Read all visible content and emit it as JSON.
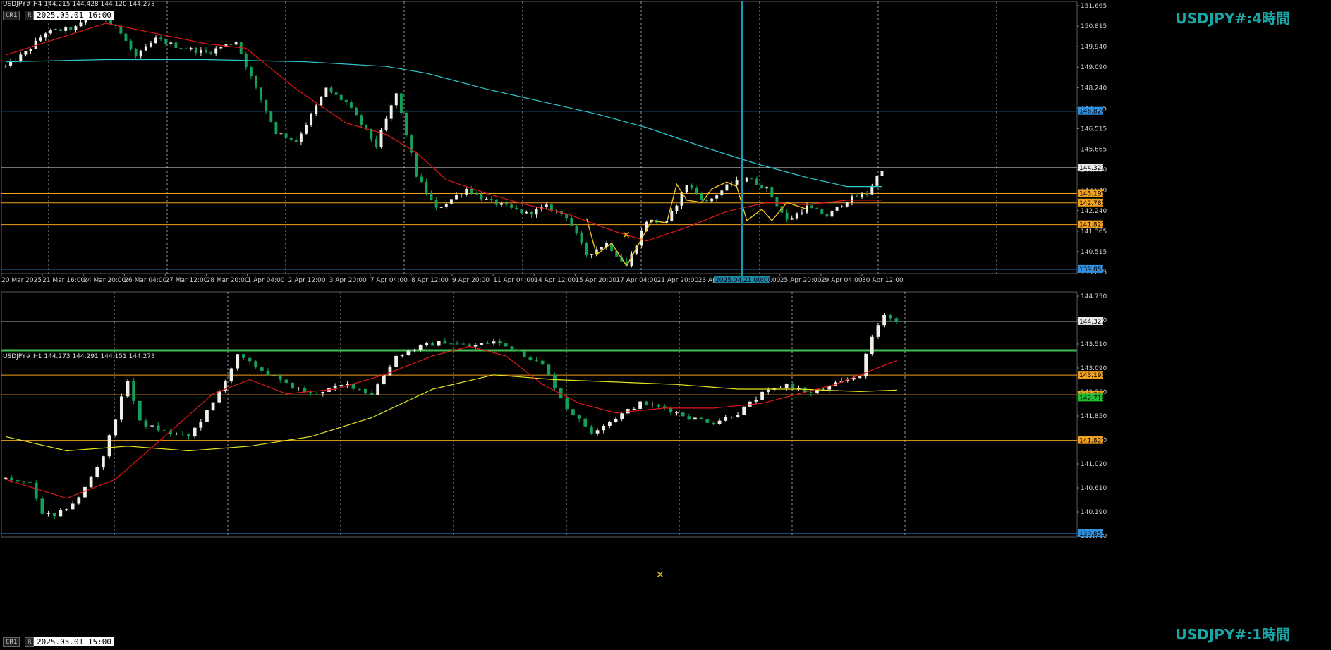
{
  "colors": {
    "bull": "#f0f0e8",
    "bear": "#14a058",
    "ma_red": "#e01818",
    "ma_cyan": "#2ec8d0",
    "ma_yellow": "#e6e61e",
    "zigzag": "#f0c020",
    "level_orange": "#f0a020",
    "level_white": "#e8e8e8",
    "level_blue": "#3090e0",
    "level_green": "#20c030",
    "grid": "#9a9a9a",
    "axis_text": "#d0d0d0",
    "title": "#19a6a6"
  },
  "window_buttons": {
    "cr": "CR1",
    "r": "R"
  },
  "top": {
    "header": "USDJPY#,H4  144.215 144.428 144.120 144.273",
    "time_stamp": "2025.05.01 16:00",
    "title": "USDJPY#:4時間",
    "cursor_time": "2025.04.21 00:00",
    "xticks": [
      "20 Mar 2025",
      "21 Mar 16:00",
      "24 Mar 20:00",
      "26 Mar 04:00",
      "27 Mar 12:00",
      "28 Mar 20:00",
      "1 Apr 04:00",
      "2 Apr 12:00",
      "3 Apr 20:00",
      "7 Apr 04:00",
      "8 Apr 12:00",
      "9 Apr 20:00",
      "11 Apr 04:00",
      "14 Apr 12:00",
      "15 Apr 20:00",
      "17 Apr 04:00",
      "21 Apr 20:00",
      "23 Apr 04:00",
      "24 Apr 12:00",
      "25 Apr 20:00",
      "29 Apr 04:00",
      "30 Apr 12:00"
    ],
    "yticks": [
      "151.665",
      "150.815",
      "149.940",
      "149.090",
      "148.240",
      "147.365",
      "146.515",
      "145.665",
      "144.790",
      "143.940",
      "142.240",
      "141.365",
      "140.515",
      "139.665"
    ]
  },
  "bottom": {
    "header": "USDJPY#,H1  144.273 144.291 144.151 144.273",
    "time_stamp": "2025.05.01 15:00",
    "title": "USDJPY#:1時間",
    "yticks": [
      "144.750",
      "143.920",
      "143.510",
      "143.090",
      "142.260",
      "141.850",
      "141.440",
      "141.020",
      "140.610",
      "140.190",
      "139.780"
    ]
  },
  "chart_data": [
    {
      "type": "candlestick",
      "symbol": "USDJPY#",
      "timeframe": "H4",
      "ylim": [
        139.665,
        151.665
      ],
      "price_labels": [
        {
          "value": "146.824",
          "color": "#3090e0",
          "price": 146.824
        },
        {
          "value": "144.327",
          "color": "#e8e8e8",
          "price": 144.327
        },
        {
          "value": "143.195",
          "color": "#f0a020",
          "price": 143.195
        },
        {
          "value": "142.780",
          "color": "#f0a020",
          "price": 142.78
        },
        {
          "value": "141.821",
          "color": "#f0a020",
          "price": 141.821
        },
        {
          "value": "139.855",
          "color": "#3090e0",
          "price": 139.855
        }
      ],
      "anchors": [
        [
          0,
          148.8
        ],
        [
          4,
          149.4
        ],
        [
          8,
          150.3
        ],
        [
          14,
          150.5
        ],
        [
          18,
          151.2
        ],
        [
          22,
          150.6
        ],
        [
          26,
          149.2
        ],
        [
          30,
          150.0
        ],
        [
          34,
          149.7
        ],
        [
          40,
          149.4
        ],
        [
          46,
          149.9
        ],
        [
          50,
          147.8
        ],
        [
          54,
          145.9
        ],
        [
          58,
          145.5
        ],
        [
          64,
          147.8
        ],
        [
          68,
          147.2
        ],
        [
          74,
          145.3
        ],
        [
          78,
          147.6
        ],
        [
          82,
          144.0
        ],
        [
          86,
          142.5
        ],
        [
          92,
          143.4
        ],
        [
          96,
          142.9
        ],
        [
          100,
          142.6
        ],
        [
          104,
          142.3
        ],
        [
          108,
          142.6
        ],
        [
          112,
          142.2
        ],
        [
          116,
          140.5
        ],
        [
          120,
          141.0
        ],
        [
          124,
          140.0
        ],
        [
          128,
          142.0
        ],
        [
          132,
          141.9
        ],
        [
          136,
          143.6
        ],
        [
          140,
          142.8
        ],
        [
          144,
          143.5
        ],
        [
          148,
          143.9
        ],
        [
          152,
          143.4
        ],
        [
          156,
          142.0
        ],
        [
          160,
          142.6
        ],
        [
          164,
          142.2
        ],
        [
          168,
          142.9
        ],
        [
          172,
          143.2
        ],
        [
          175,
          144.3
        ]
      ],
      "ma_red": [
        [
          0,
          149.3
        ],
        [
          20,
          150.7
        ],
        [
          40,
          149.8
        ],
        [
          48,
          149.6
        ],
        [
          58,
          147.8
        ],
        [
          68,
          146.3
        ],
        [
          76,
          145.8
        ],
        [
          82,
          145.0
        ],
        [
          88,
          143.8
        ],
        [
          96,
          143.2
        ],
        [
          104,
          142.7
        ],
        [
          112,
          142.3
        ],
        [
          122,
          141.5
        ],
        [
          128,
          141.1
        ],
        [
          136,
          141.7
        ],
        [
          144,
          142.4
        ],
        [
          152,
          142.8
        ],
        [
          160,
          142.7
        ],
        [
          168,
          142.9
        ],
        [
          175,
          142.9
        ]
      ],
      "ma_cyan": [
        [
          0,
          149.0
        ],
        [
          20,
          149.1
        ],
        [
          40,
          149.1
        ],
        [
          60,
          149.0
        ],
        [
          76,
          148.8
        ],
        [
          84,
          148.5
        ],
        [
          96,
          147.8
        ],
        [
          108,
          147.2
        ],
        [
          118,
          146.7
        ],
        [
          128,
          146.1
        ],
        [
          140,
          145.2
        ],
        [
          150,
          144.5
        ],
        [
          160,
          143.9
        ],
        [
          168,
          143.5
        ],
        [
          175,
          143.5
        ]
      ],
      "zigzag": [
        [
          116,
          142.1
        ],
        [
          118,
          140.5
        ],
        [
          121,
          141.0
        ],
        [
          124,
          140.0
        ],
        [
          127,
          141.2
        ],
        [
          129,
          142.0
        ],
        [
          132,
          141.9
        ],
        [
          134,
          143.6
        ],
        [
          136,
          142.9
        ],
        [
          139,
          142.8
        ],
        [
          141,
          143.4
        ],
        [
          144,
          143.7
        ],
        [
          146,
          143.5
        ],
        [
          148,
          142.0
        ],
        [
          151,
          142.5
        ],
        [
          153,
          142.0
        ],
        [
          156,
          142.8
        ],
        [
          160,
          142.5
        ]
      ]
    },
    {
      "type": "candlestick",
      "symbol": "USDJPY#",
      "timeframe": "H1",
      "ylim": [
        139.78,
        144.95
      ],
      "price_labels": [
        {
          "value": "144.327",
          "color": "#e8e8e8",
          "price": 144.327
        },
        {
          "value": "143.195",
          "color": "#f0a020",
          "price": 143.195
        },
        {
          "value": "142.780",
          "color": "#f0a020",
          "price": 142.78
        },
        {
          "value": "142.716",
          "color": "#20c030",
          "price": 142.716
        },
        {
          "value": "141.821",
          "color": "#f0a020",
          "price": 141.821
        },
        {
          "value": "139.855",
          "color": "#3090e0",
          "price": 139.855
        }
      ],
      "anchors": [
        [
          0,
          141.0
        ],
        [
          4,
          140.9
        ],
        [
          6,
          140.3
        ],
        [
          8,
          140.2
        ],
        [
          12,
          140.6
        ],
        [
          16,
          141.5
        ],
        [
          20,
          143.1
        ],
        [
          22,
          142.2
        ],
        [
          26,
          142.0
        ],
        [
          30,
          141.9
        ],
        [
          34,
          142.6
        ],
        [
          38,
          143.6
        ],
        [
          42,
          143.3
        ],
        [
          46,
          143.0
        ],
        [
          50,
          142.8
        ],
        [
          56,
          143.0
        ],
        [
          60,
          142.8
        ],
        [
          64,
          143.6
        ],
        [
          68,
          143.8
        ],
        [
          72,
          143.9
        ],
        [
          76,
          143.8
        ],
        [
          80,
          143.9
        ],
        [
          84,
          143.7
        ],
        [
          88,
          143.4
        ],
        [
          92,
          142.5
        ],
        [
          96,
          142.0
        ],
        [
          100,
          142.3
        ],
        [
          104,
          142.6
        ],
        [
          108,
          142.5
        ],
        [
          112,
          142.3
        ],
        [
          116,
          142.2
        ],
        [
          120,
          142.4
        ],
        [
          124,
          142.8
        ],
        [
          128,
          143.0
        ],
        [
          132,
          142.8
        ],
        [
          136,
          143.0
        ],
        [
          140,
          143.2
        ],
        [
          142,
          144.0
        ],
        [
          144,
          144.5
        ],
        [
          146,
          144.3
        ]
      ],
      "ma_red": [
        [
          0,
          141.0
        ],
        [
          10,
          140.6
        ],
        [
          18,
          141.0
        ],
        [
          26,
          141.9
        ],
        [
          34,
          142.8
        ],
        [
          40,
          143.1
        ],
        [
          46,
          142.8
        ],
        [
          54,
          142.9
        ],
        [
          62,
          143.2
        ],
        [
          70,
          143.6
        ],
        [
          76,
          143.8
        ],
        [
          82,
          143.6
        ],
        [
          88,
          143.0
        ],
        [
          94,
          142.6
        ],
        [
          100,
          142.4
        ],
        [
          108,
          142.5
        ],
        [
          116,
          142.5
        ],
        [
          124,
          142.6
        ],
        [
          130,
          142.8
        ],
        [
          136,
          143.0
        ],
        [
          140,
          143.2
        ],
        [
          146,
          143.5
        ]
      ],
      "ma_yellow": [
        [
          0,
          141.9
        ],
        [
          10,
          141.6
        ],
        [
          20,
          141.7
        ],
        [
          30,
          141.6
        ],
        [
          40,
          141.7
        ],
        [
          50,
          141.9
        ],
        [
          60,
          142.3
        ],
        [
          70,
          142.9
        ],
        [
          80,
          143.2
        ],
        [
          90,
          143.1
        ],
        [
          100,
          143.05
        ],
        [
          110,
          143.0
        ],
        [
          120,
          142.9
        ],
        [
          130,
          142.9
        ],
        [
          140,
          142.85
        ],
        [
          146,
          142.88
        ]
      ]
    }
  ]
}
